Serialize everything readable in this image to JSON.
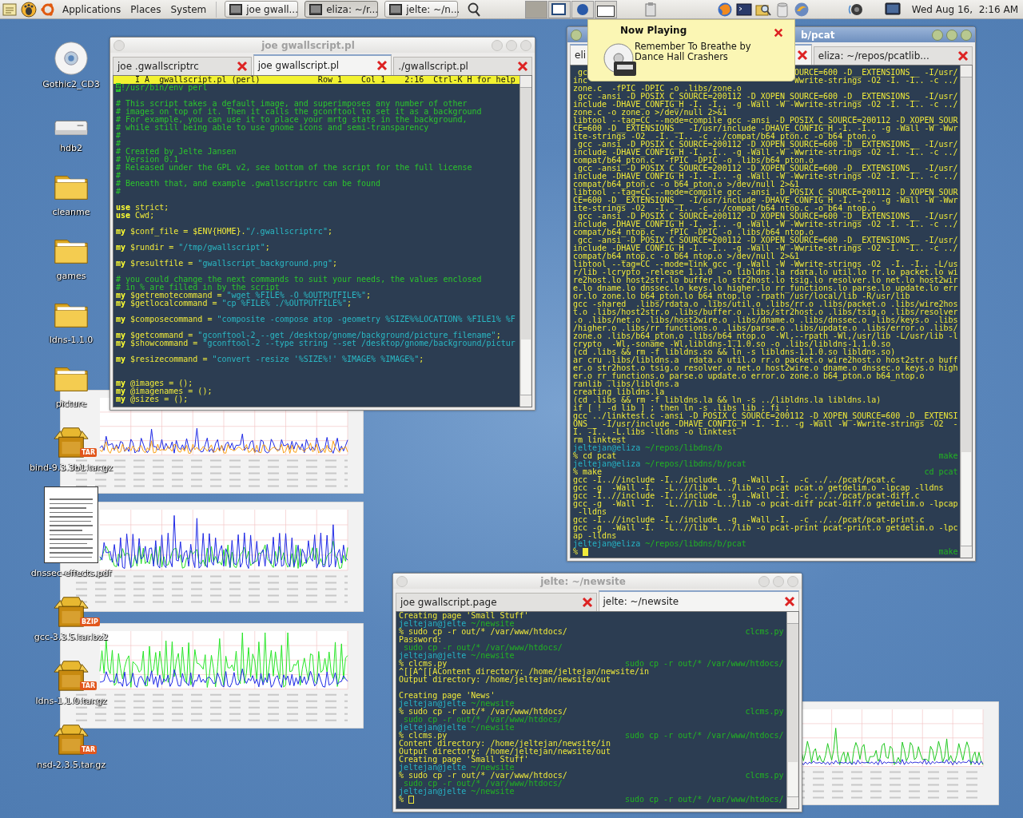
{
  "panel": {
    "menus": [
      "Applications",
      "Places",
      "System"
    ],
    "tasks": [
      {
        "label": "joe gwall...",
        "selected": false
      },
      {
        "label": "eliza: ~/r...",
        "selected": true
      },
      {
        "label": "jelte: ~/n...",
        "selected": false
      }
    ],
    "clock": "Wed Aug 16,  2:16 AM"
  },
  "desktop_icons": [
    {
      "label": "Gothic2_CD3",
      "kind": "cd"
    },
    {
      "label": "hdb2",
      "kind": "drive"
    },
    {
      "label": "cleanme",
      "kind": "folder"
    },
    {
      "label": "games",
      "kind": "folder"
    },
    {
      "label": "ldns-1.1.0",
      "kind": "folder"
    },
    {
      "label": "picture",
      "kind": "folder"
    },
    {
      "label": "bind-9.3.3b1.tar.gz",
      "kind": "package",
      "badge": "TAR"
    },
    {
      "label": "dnssec-effects.pdf",
      "kind": "document"
    },
    {
      "label": "gcc-3.3.5.tar.bz2",
      "kind": "package",
      "badge": "BZIP"
    },
    {
      "label": "ldns-1.1.0.tar.gz",
      "kind": "package",
      "badge": "TAR"
    },
    {
      "label": "nsd-2.3.5.tar.gz",
      "kind": "package",
      "badge": "TAR"
    }
  ],
  "editor": {
    "title": "joe gwallscript.pl",
    "focused": false,
    "tabs": [
      {
        "label": "joe .gwallscriptrc",
        "selected": false
      },
      {
        "label": "joe gwallscript.pl",
        "selected": true
      },
      {
        "label": "./gwallscript.pl",
        "selected": false
      }
    ],
    "status": "    I A  gwallscript.pl (perl)            Row 1    Col 1    2:16  Ctrl-K H for help",
    "lines": [
      {
        "kind": "code",
        "segments": [
          {
            "kind": "cursor",
            "text": "#"
          },
          {
            "kind": "comment",
            "text": "!/usr/bin/env perl"
          }
        ]
      },
      {
        "kind": "blank"
      },
      {
        "kind": "code",
        "segments": [
          {
            "kind": "comment",
            "text": "# This script takes a default image, and superimposes any number of other"
          }
        ]
      },
      {
        "kind": "code",
        "segments": [
          {
            "kind": "comment",
            "text": "# images on top of it. Then it calls the gconftool to set it as a background"
          }
        ]
      },
      {
        "kind": "code",
        "segments": [
          {
            "kind": "comment",
            "text": "# For example, you can use it to place your mrtg stats in the background,"
          }
        ]
      },
      {
        "kind": "code",
        "segments": [
          {
            "kind": "comment",
            "text": "# while still being able to use gnome icons and semi-transparency"
          }
        ]
      },
      {
        "kind": "code",
        "segments": [
          {
            "kind": "comment",
            "text": "#"
          }
        ]
      },
      {
        "kind": "code",
        "segments": [
          {
            "kind": "comment",
            "text": "#"
          }
        ]
      },
      {
        "kind": "code",
        "segments": [
          {
            "kind": "comment",
            "text": "# Created by Jelte Jansen"
          }
        ]
      },
      {
        "kind": "code",
        "segments": [
          {
            "kind": "comment",
            "text": "# Version 0.1"
          }
        ]
      },
      {
        "kind": "code",
        "segments": [
          {
            "kind": "comment",
            "text": "# Released under the GPL v2, see bottom of the script for the full license"
          }
        ]
      },
      {
        "kind": "code",
        "segments": [
          {
            "kind": "comment",
            "text": "#"
          }
        ]
      },
      {
        "kind": "code",
        "segments": [
          {
            "kind": "comment",
            "text": "# Beneath that, and example .gwallscriptrc can be found"
          }
        ]
      },
      {
        "kind": "code",
        "segments": [
          {
            "kind": "comment",
            "text": "#"
          }
        ]
      },
      {
        "kind": "blank"
      },
      {
        "kind": "code",
        "segments": [
          {
            "kind": "keyword",
            "text": "use"
          },
          {
            "kind": "plain",
            "text": " strict;"
          }
        ]
      },
      {
        "kind": "code",
        "segments": [
          {
            "kind": "keyword",
            "text": "use"
          },
          {
            "kind": "plain",
            "text": " Cwd;"
          }
        ]
      },
      {
        "kind": "blank"
      },
      {
        "kind": "code",
        "segments": [
          {
            "kind": "keyword",
            "text": "my"
          },
          {
            "kind": "plain",
            "text": " $conf_file = $ENV{HOME}."
          },
          {
            "kind": "string",
            "text": "\"/.gwallscriptrc\""
          },
          {
            "kind": "plain",
            "text": ";"
          }
        ]
      },
      {
        "kind": "blank"
      },
      {
        "kind": "code",
        "segments": [
          {
            "kind": "keyword",
            "text": "my"
          },
          {
            "kind": "plain",
            "text": " $rundir = "
          },
          {
            "kind": "string",
            "text": "\"/tmp/gwallscript\""
          },
          {
            "kind": "plain",
            "text": ";"
          }
        ]
      },
      {
        "kind": "blank"
      },
      {
        "kind": "code",
        "segments": [
          {
            "kind": "keyword",
            "text": "my"
          },
          {
            "kind": "plain",
            "text": " $resultfile = "
          },
          {
            "kind": "string",
            "text": "\"gwallscript_background.png\""
          },
          {
            "kind": "plain",
            "text": ";"
          }
        ]
      },
      {
        "kind": "blank"
      },
      {
        "kind": "code",
        "segments": [
          {
            "kind": "comment",
            "text": "# you could change the next commands to suit your needs, the values enclosed"
          }
        ]
      },
      {
        "kind": "code",
        "segments": [
          {
            "kind": "comment",
            "text": "# in % are filled in by the script"
          }
        ]
      },
      {
        "kind": "code",
        "segments": [
          {
            "kind": "keyword",
            "text": "my"
          },
          {
            "kind": "plain",
            "text": " $getremotecommand = "
          },
          {
            "kind": "string",
            "text": "\"wget %FILE% -O %OUTPUTFILE%\""
          },
          {
            "kind": "plain",
            "text": ";"
          }
        ]
      },
      {
        "kind": "code",
        "segments": [
          {
            "kind": "keyword",
            "text": "my"
          },
          {
            "kind": "plain",
            "text": " $getlocalcommand = "
          },
          {
            "kind": "string",
            "text": "\"cp %FILE% ./%OUTPUTFILE%\""
          },
          {
            "kind": "plain",
            "text": ";"
          }
        ]
      },
      {
        "kind": "blank"
      },
      {
        "kind": "code",
        "segments": [
          {
            "kind": "keyword",
            "text": "my"
          },
          {
            "kind": "plain",
            "text": " $composecommand = "
          },
          {
            "kind": "string",
            "text": "\"composite -compose atop -geometry %SIZE%%LOCATION% %FILE1% %F"
          }
        ]
      },
      {
        "kind": "blank"
      },
      {
        "kind": "code",
        "segments": [
          {
            "kind": "keyword",
            "text": "my"
          },
          {
            "kind": "plain",
            "text": " $getcommand = "
          },
          {
            "kind": "string",
            "text": "\"gconftool-2 --get /desktop/gnome/background/picture_filename\""
          },
          {
            "kind": "plain",
            "text": ";"
          }
        ]
      },
      {
        "kind": "code",
        "segments": [
          {
            "kind": "keyword",
            "text": "my"
          },
          {
            "kind": "plain",
            "text": " $showcommand = "
          },
          {
            "kind": "string",
            "text": "\"gconftool-2 --type string --set /desktop/gnome/background/pictur"
          }
        ]
      },
      {
        "kind": "blank"
      },
      {
        "kind": "code",
        "segments": [
          {
            "kind": "keyword",
            "text": "my"
          },
          {
            "kind": "plain",
            "text": " $resizecommand = "
          },
          {
            "kind": "string",
            "text": "\"convert -resize '%SIZE%!' %IMAGE% %IMAGE%\""
          },
          {
            "kind": "plain",
            "text": ";"
          }
        ]
      },
      {
        "kind": "blank"
      },
      {
        "kind": "blank"
      },
      {
        "kind": "code",
        "segments": [
          {
            "kind": "keyword",
            "text": "my"
          },
          {
            "kind": "plain",
            "text": " @images = ();"
          }
        ]
      },
      {
        "kind": "code",
        "segments": [
          {
            "kind": "keyword",
            "text": "my"
          },
          {
            "kind": "plain",
            "text": " @imagenames = ();"
          }
        ]
      },
      {
        "kind": "code",
        "segments": [
          {
            "kind": "keyword",
            "text": "my"
          },
          {
            "kind": "plain",
            "text": " @sizes = ();"
          }
        ]
      }
    ]
  },
  "notification": {
    "title": "Now Playing",
    "text": "Remember To Breathe by Dance Hall Crashers"
  },
  "terminals": [
    {
      "title": "b/pcat",
      "focused": true,
      "tabs": [
        {
          "label": "eli",
          "selected": true
        },
        {
          "label": "eliza:  ~/repos/pcatlib...",
          "selected": false
        }
      ],
      "lines": [
        {
          "kind": "split",
          "text": " gc",
          "right": "OURCE=600 -D__EXTENSIONS__ -I/usr/"
        },
        {
          "kind": "split",
          "text": "inc",
          "right": "Wwrite-strings -O2 -I. -I.. -c ../"
        },
        {
          "kind": "out",
          "text": "zone.c  -fPIC -DPIC -o .libs/zone.o"
        },
        {
          "kind": "out",
          "text": " gcc -ansi -D_POSIX_C_SOURCE=200112 -D_XOPEN_SOURCE=600 -D__EXTENSIONS__ -I/usr/"
        },
        {
          "kind": "out",
          "text": "include -DHAVE_CONFIG_H -I. -I.. -g -Wall -W -Wwrite-strings -O2 -I. -I.. -c ../"
        },
        {
          "kind": "out",
          "text": "zone.c -o zone.o >/dev/null 2>&1"
        },
        {
          "kind": "out",
          "text": "libtool --tag=CC --mode=compile gcc -ansi -D_POSIX_C_SOURCE=200112 -D_XOPEN_SOUR"
        },
        {
          "kind": "out",
          "text": "CE=600 -D__EXTENSIONS__ -I/usr/include -DHAVE_CONFIG_H -I. -I.. -g -Wall -W -Wwr"
        },
        {
          "kind": "out",
          "text": "ite-strings -O2  -I. -I.. -c ../compat/b64_pton.c -o b64_pton.o"
        },
        {
          "kind": "out",
          "text": " gcc -ansi -D_POSIX_C_SOURCE=200112 -D_XOPEN_SOURCE=600 -D__EXTENSIONS__ -I/usr/"
        },
        {
          "kind": "out",
          "text": "include -DHAVE_CONFIG_H -I. -I.. -g -Wall -W -Wwrite-strings -O2 -I. -I.. -c ../"
        },
        {
          "kind": "out",
          "text": "compat/b64_pton.c  -fPIC -DPIC -o .libs/b64_pton.o"
        },
        {
          "kind": "out",
          "text": " gcc -ansi -D_POSIX_C_SOURCE=200112 -D_XOPEN_SOURCE=600 -D__EXTENSIONS__ -I/usr/"
        },
        {
          "kind": "out",
          "text": "include -DHAVE_CONFIG_H -I. -I.. -g -Wall -W -Wwrite-strings -O2 -I. -I.. -c ../"
        },
        {
          "kind": "out",
          "text": "compat/b64_pton.c -o b64_pton.o >/dev/null 2>&1"
        },
        {
          "kind": "out",
          "text": "libtool --tag=CC --mode=compile gcc -ansi -D_POSIX_C_SOURCE=200112 -D_XOPEN_SOUR"
        },
        {
          "kind": "out",
          "text": "CE=600 -D__EXTENSIONS__ -I/usr/include -DHAVE_CONFIG_H -I. -I.. -g -Wall -W -Wwr"
        },
        {
          "kind": "out",
          "text": "ite-strings -O2  -I. -I.. -c ../compat/b64_ntop.c -o b64_ntop.o"
        },
        {
          "kind": "out",
          "text": " gcc -ansi -D_POSIX_C_SOURCE=200112 -D_XOPEN_SOURCE=600 -D__EXTENSIONS__ -I/usr/"
        },
        {
          "kind": "out",
          "text": "include -DHAVE_CONFIG_H -I. -I.. -g -Wall -W -Wwrite-strings -O2 -I. -I.. -c ../"
        },
        {
          "kind": "out",
          "text": "compat/b64_ntop.c  -fPIC -DPIC -o .libs/b64_ntop.o"
        },
        {
          "kind": "out",
          "text": " gcc -ansi -D_POSIX_C_SOURCE=200112 -D_XOPEN_SOURCE=600 -D__EXTENSIONS__ -I/usr/"
        },
        {
          "kind": "out",
          "text": "include -DHAVE_CONFIG_H -I. -I.. -g -Wall -W -Wwrite-strings -O2 -I. -I.. -c ../"
        },
        {
          "kind": "out",
          "text": "compat/b64_ntop.c -o b64_ntop.o >/dev/null 2>&1"
        },
        {
          "kind": "out",
          "text": "libtool --tag=CC --mode=link gcc -g -Wall -W -Wwrite-strings -O2  -I. -I.. -L/us"
        },
        {
          "kind": "out",
          "text": "r/lib -lcrypto -release 1.1.0  -o libldns.la rdata.lo util.lo rr.lo packet.lo wi"
        },
        {
          "kind": "out",
          "text": "re2host.lo host2str.lo buffer.lo str2host.lo tsig.lo resolver.lo net.lo host2wir"
        },
        {
          "kind": "out",
          "text": "e.lo dname.lo dnssec.lo keys.lo higher.lo rr_functions.lo parse.lo update.lo err"
        },
        {
          "kind": "out",
          "text": "or.lo zone.lo b64_pton.lo b64_ntop.lo -rpath /usr/local/lib -R/usr/lib"
        },
        {
          "kind": "out",
          "text": "gcc -shared  .libs/rdata.o .libs/util.o .libs/rr.o .libs/packet.o .libs/wire2hos"
        },
        {
          "kind": "out",
          "text": "t.o .libs/host2str.o .libs/buffer.o .libs/str2host.o .libs/tsig.o .libs/resolver"
        },
        {
          "kind": "out",
          "text": ".o .libs/net.o .libs/host2wire.o .libs/dname.o .libs/dnssec.o .libs/keys.o .libs"
        },
        {
          "kind": "out",
          "text": "/higher.o .libs/rr_functions.o .libs/parse.o .libs/update.o .libs/error.o .libs/"
        },
        {
          "kind": "out",
          "text": "zone.o .libs/b64_pton.o .libs/b64_ntop.o  -Wl,--rpath -Wl,/usr/lib -L/usr/lib -l"
        },
        {
          "kind": "out",
          "text": "crypto  -Wl,-soname -Wl,libldns-1.1.0.so -o .libs/libldns-1.1.0.so"
        },
        {
          "kind": "out",
          "text": "(cd .libs && rm -f libldns.so && ln -s libldns-1.1.0.so libldns.so)"
        },
        {
          "kind": "out",
          "text": "ar cru .libs/libldns.a  rdata.o util.o rr.o packet.o wire2host.o host2str.o buff"
        },
        {
          "kind": "out",
          "text": "er.o str2host.o tsig.o resolver.o net.o host2wire.o dname.o dnssec.o keys.o high"
        },
        {
          "kind": "out",
          "text": "er.o rr_functions.o parse.o update.o error.o zone.o b64_pton.o b64_ntop.o"
        },
        {
          "kind": "out",
          "text": "ranlib .libs/libldns.a"
        },
        {
          "kind": "out",
          "text": "creating libldns.la"
        },
        {
          "kind": "out",
          "text": "(cd .libs && rm -f libldns.la && ln -s ../libldns.la libldns.la)"
        },
        {
          "kind": "out",
          "text": "if [ ! -d lib ] ; then ln -s .libs lib ; fi ;"
        },
        {
          "kind": "out",
          "text": "gcc ../linktest.c -ansi -D_POSIX_C_SOURCE=200112 -D_XOPEN_SOURCE=600 -D__EXTENSI"
        },
        {
          "kind": "out",
          "text": "ONS__ -I/usr/include -DHAVE_CONFIG_H -I. -I.. -g -Wall -W -Wwrite-strings -O2  -"
        },
        {
          "kind": "out",
          "text": "I. -I.. -L.libs -lldns -o linktest"
        },
        {
          "kind": "out",
          "text": "rm linktest"
        },
        {
          "kind": "prompt",
          "user": "jeltejan@eliza",
          "path": "~/repos/libdns/b"
        },
        {
          "kind": "cmd",
          "text": "% cd pcat",
          "right": "make"
        },
        {
          "kind": "prompt",
          "user": "jeltejan@eliza",
          "path": "~/repos/libdns/b/pcat"
        },
        {
          "kind": "cmd",
          "text": "% make",
          "right": "cd pcat"
        },
        {
          "kind": "out",
          "text": "gcc -I..//include -I../include  -g  -Wall -I.  -c ../../pcat/pcat.c"
        },
        {
          "kind": "out",
          "text": "gcc -g  -Wall -I.  -L..//lib -L../lib -o pcat pcat.o getdelim.o -lpcap -lldns"
        },
        {
          "kind": "out",
          "text": "gcc -I..//include -I../include  -g  -Wall -I.  -c ../../pcat/pcat-diff.c"
        },
        {
          "kind": "out",
          "text": "gcc -g  -Wall -I.  -L..//lib -L../lib -o pcat-diff pcat-diff.o getdelim.o -lpcap"
        },
        {
          "kind": "out",
          "text": " -lldns"
        },
        {
          "kind": "out",
          "text": "gcc -I..//include -I../include  -g  -Wall -I.  -c ../../pcat/pcat-print.c"
        },
        {
          "kind": "out",
          "text": "gcc -g  -Wall -I.  -L..//lib -L../lib -o pcat-print pcat-print.o getdelim.o -lpc"
        },
        {
          "kind": "out",
          "text": "ap -lldns"
        },
        {
          "kind": "prompt",
          "user": "jeltejan@eliza",
          "path": "~/repos/libdns/b/pcat"
        },
        {
          "kind": "cmd",
          "text": "%",
          "right": "make",
          "cursor": true
        }
      ]
    },
    {
      "title": "jelte: ~/newsite",
      "focused": false,
      "tabs": [
        {
          "label": "joe gwallscript.page",
          "selected": false
        },
        {
          "label": "jelte:  ~/newsite",
          "selected": true
        }
      ],
      "lines": [
        {
          "kind": "out",
          "text": "Creating page 'Small Stuff'"
        },
        {
          "kind": "prompt",
          "user": "jeltejan@jelte",
          "path": "~/newsite"
        },
        {
          "kind": "cmd",
          "text": "% sudo cp -r out/* /var/www/htdocs/",
          "right": "clcms.py"
        },
        {
          "kind": "out",
          "text": "Password:"
        },
        {
          "kind": "echo",
          "text": " sudo cp -r out/* /var/www/htdocs/"
        },
        {
          "kind": "prompt",
          "user": "jeltejan@jelte",
          "path": "~/newsite"
        },
        {
          "kind": "cmd",
          "text": "% clcms.py",
          "right": "sudo cp -r out/* /var/www/htdocs/"
        },
        {
          "kind": "out",
          "text": "^[[A^[[AContent directory: /home/jeltejan/newsite/in"
        },
        {
          "kind": "out",
          "text": "Output directory: /home/jeltejan/newsite/out"
        },
        {
          "kind": "blank"
        },
        {
          "kind": "out",
          "text": "Creating page 'News'"
        },
        {
          "kind": "prompt",
          "user": "jeltejan@jelte",
          "path": "~/newsite"
        },
        {
          "kind": "cmd",
          "text": "% sudo cp -r out/* /var/www/htdocs/",
          "right": "clcms.py"
        },
        {
          "kind": "echo",
          "text": " sudo cp -r out/* /var/www/htdocs/"
        },
        {
          "kind": "prompt",
          "user": "jeltejan@jelte",
          "path": "~/newsite"
        },
        {
          "kind": "cmd",
          "text": "% clcms.py",
          "right": "sudo cp -r out/* /var/www/htdocs/"
        },
        {
          "kind": "out",
          "text": "Content directory: /home/jeltejan/newsite/in"
        },
        {
          "kind": "out",
          "text": "Output directory: /home/jeltejan/newsite/out"
        },
        {
          "kind": "out",
          "text": "Creating page 'Small Stuff'"
        },
        {
          "kind": "prompt",
          "user": "jeltejan@jelte",
          "path": "~/newsite"
        },
        {
          "kind": "cmd",
          "text": "% sudo cp -r out/* /var/www/htdocs/",
          "right": "clcms.py"
        },
        {
          "kind": "echo",
          "text": " sudo cp -r out/* /var/www/htdocs/"
        },
        {
          "kind": "prompt",
          "user": "jeltejan@jelte",
          "path": "~/newsite"
        },
        {
          "kind": "cmd",
          "text": "%",
          "right": "sudo cp -r out/* /var/www/htdocs/",
          "cursor": true
        }
      ]
    }
  ]
}
